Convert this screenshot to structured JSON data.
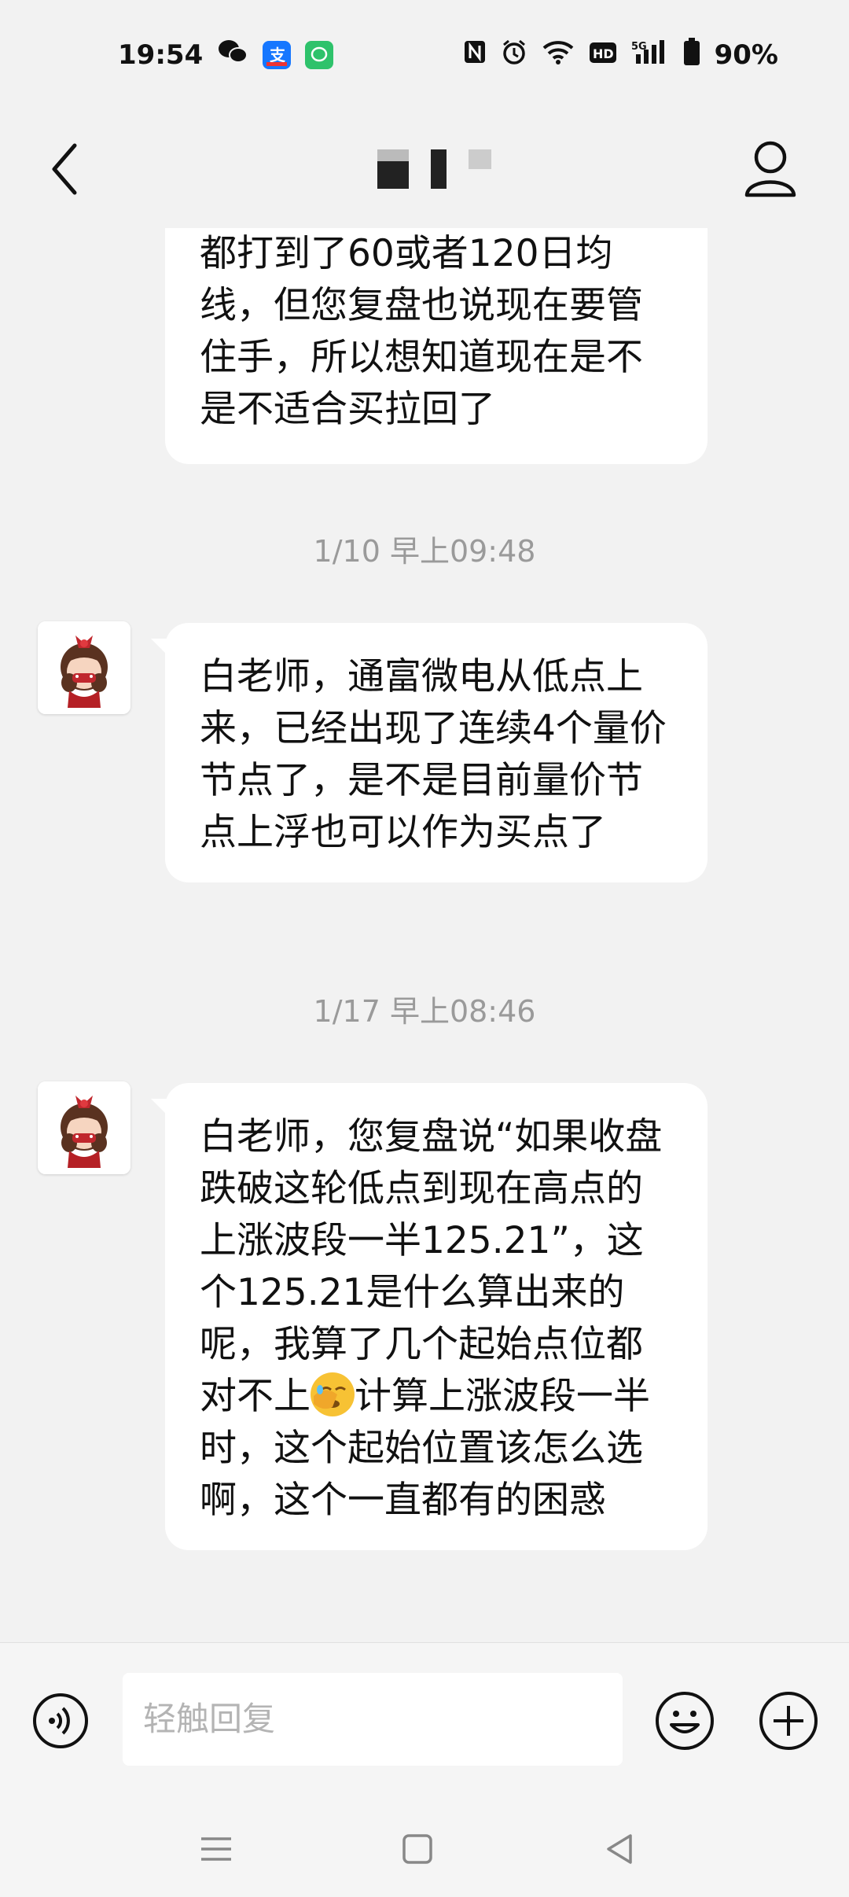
{
  "status_bar": {
    "time": "19:54",
    "battery": "90%",
    "app_icons": [
      "wechat-icon",
      "alipay-icon",
      "messages-icon"
    ],
    "system_icons": [
      "nfc-icon",
      "alarm-icon",
      "wifi-icon",
      "hd-icon",
      "signal-5g-icon",
      "battery-icon"
    ]
  },
  "header": {
    "back_icon": "back-chevron-icon",
    "profile_icon": "person-icon"
  },
  "messages": [
    {
      "text": "都打到了60或者120日均线，但您复盘也说现在要管住手，所以想知道现在是不是不适合买拉回了"
    },
    {
      "timestamp": "1/10 早上09:48",
      "text": "白老师，通富微电从低点上来，已经出现了连续4个量价节点了，是不是目前量价节点上浮也可以作为买点了"
    },
    {
      "timestamp": "1/17 早上08:46",
      "text_before_emoji": "白老师，您复盘说“如果收盘跌破这轮低点到现在高点的上涨波段一半125.21”，这个125.21是什么算出来的呢，我算了几个起始点位都对不上",
      "emoji": "facepalm-emoji",
      "text_after_emoji": "计算上涨波段一半时，这个起始位置该怎么选啊，这个一直都有的困惑"
    }
  ],
  "input_bar": {
    "placeholder": "轻触回复",
    "voice_icon": "voice-icon",
    "emoji_icon": "smiley-icon",
    "plus_icon": "plus-icon"
  },
  "nav_bar": {
    "items": [
      "menu-icon",
      "home-icon",
      "back-triangle-icon"
    ]
  },
  "colors": {
    "background": "#f2f2f2",
    "bubble": "#ffffff",
    "timestamp": "#9a9a9a",
    "placeholder": "#b4b4b4"
  }
}
